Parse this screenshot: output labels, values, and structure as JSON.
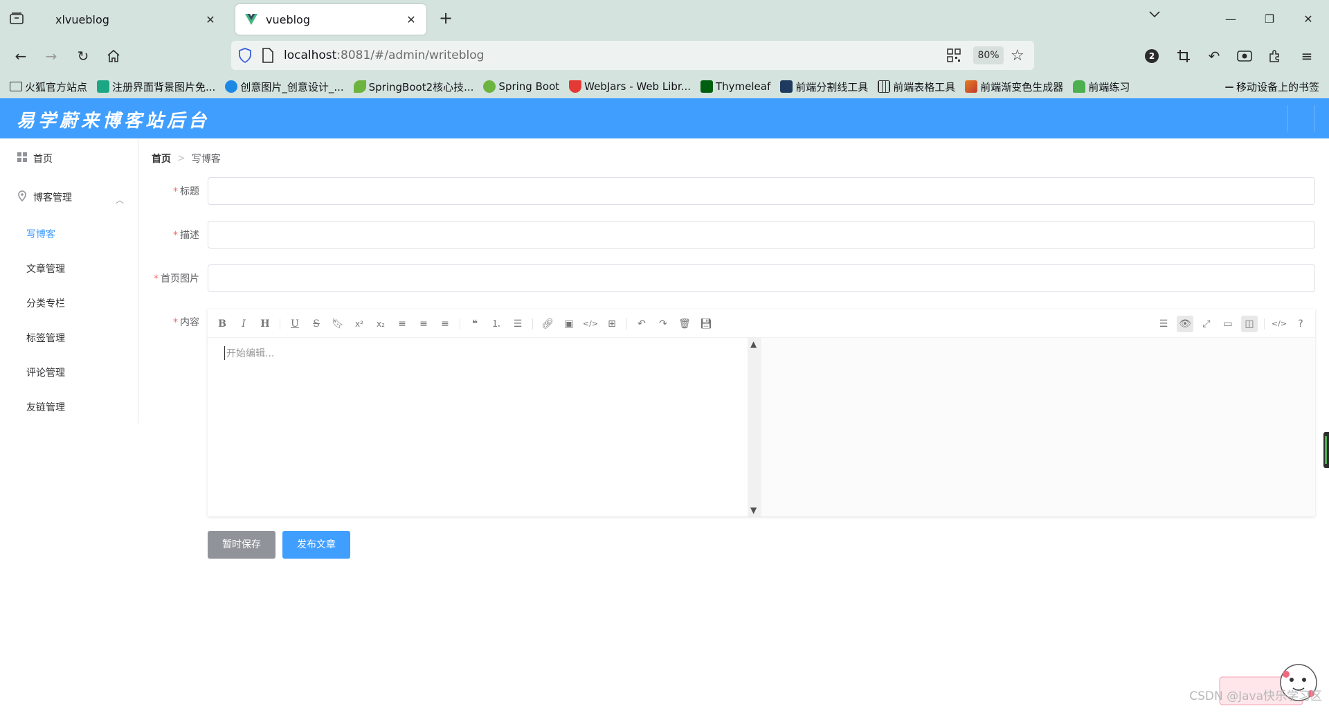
{
  "browser": {
    "tabs": [
      {
        "title": "xlvueblog",
        "active": false
      },
      {
        "title": "vueblog",
        "active": true
      }
    ],
    "url_host": "localhost",
    "url_path": ":8081/#/admin/writeblog",
    "zoom": "80%",
    "notification_count": "2",
    "bookmarks": [
      {
        "label": "火狐官方站点",
        "icon": "folder-icon",
        "color": "#333333"
      },
      {
        "label": "注册界面背景图片免...",
        "icon": "image-site-icon",
        "color": "#1ba784"
      },
      {
        "label": "创意图片_创意设计_...",
        "icon": "creative-site-icon",
        "color": "#1e88e5"
      },
      {
        "label": "SpringBoot2核心技...",
        "icon": "leaf-icon",
        "color": "#6db33f"
      },
      {
        "label": "Spring Boot",
        "icon": "spring-icon",
        "color": "#6db33f"
      },
      {
        "label": "WebJars - Web Libr...",
        "icon": "webjars-icon",
        "color": "#e53935"
      },
      {
        "label": "Thymeleaf",
        "icon": "thymeleaf-icon",
        "color": "#005f0f"
      },
      {
        "label": "前端分割线工具",
        "icon": "divider-tool-icon",
        "color": "#1e3a5f"
      },
      {
        "label": "前端表格工具",
        "icon": "table-tool-icon",
        "color": "#333333"
      },
      {
        "label": "前端渐变色生成器",
        "icon": "gradient-tool-icon",
        "color": "#c0392b"
      },
      {
        "label": "前端练习",
        "icon": "practice-icon",
        "color": "#4caf50"
      }
    ],
    "mobile_bookmarks": "移动设备上的书签"
  },
  "app": {
    "title": "易学蔚来博客站后台",
    "accent_color": "#409eff"
  },
  "sidebar": {
    "home": "首页",
    "blog_group": "博客管理",
    "items": [
      {
        "label": "写博客",
        "active": true
      },
      {
        "label": "文章管理",
        "active": false
      },
      {
        "label": "分类专栏",
        "active": false
      },
      {
        "label": "标签管理",
        "active": false
      },
      {
        "label": "评论管理",
        "active": false
      },
      {
        "label": "友链管理",
        "active": false
      }
    ]
  },
  "breadcrumb": {
    "home": "首页",
    "current": "写博客"
  },
  "form": {
    "required_mark": "*",
    "title_label": "标题",
    "description_label": "描述",
    "cover_label": "首页图片",
    "content_label": "内容",
    "editor_placeholder": "开始编辑..."
  },
  "buttons": {
    "save_draft": "暂时保存",
    "publish": "发布文章"
  },
  "watermark": "CSDN @Java快乐学习区"
}
